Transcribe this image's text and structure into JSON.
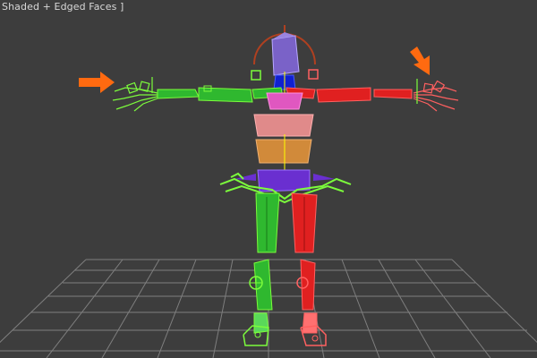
{
  "viewport": {
    "label": "Shaded + Edged Faces ]",
    "background": "#3d3d3d",
    "grid_color": "#8a8a8a"
  },
  "rig": {
    "colors": {
      "left_side": "#2fb82f",
      "right_side": "#e02020",
      "pelvis": "#6a2fd0",
      "spine_lower": "#d18a3a",
      "spine_upper": "#e08a8a",
      "chest": "#e057c0",
      "neck": "#1020d0",
      "head": "#7a62c8",
      "control_green": "#7cfc3c",
      "control_red": "#ff6060",
      "head_circle": "#b04020"
    }
  },
  "annotations": {
    "arrow_color": "#ff6a10",
    "arrows": [
      "left-hand-arrow",
      "right-hand-arrow"
    ]
  }
}
